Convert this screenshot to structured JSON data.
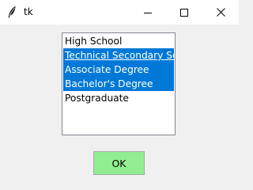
{
  "window": {
    "title": "tk"
  },
  "titlebar": {
    "app_icon": "feather-icon",
    "minimize_icon": "minimize-icon",
    "maximize_icon": "maximize-icon",
    "close_icon": "close-icon"
  },
  "listbox": {
    "items": [
      {
        "label": "High School",
        "selected": false
      },
      {
        "label": "Technical Secondary School",
        "selected": true,
        "active": true
      },
      {
        "label": "Associate Degree",
        "selected": true
      },
      {
        "label": "Bachelor's Degree",
        "selected": true
      },
      {
        "label": "Postgraduate",
        "selected": false
      }
    ]
  },
  "ok_button": {
    "label": "OK"
  },
  "colors": {
    "background": "#f0f0f0",
    "selection": "#0078d7",
    "button": "#90ee90"
  }
}
